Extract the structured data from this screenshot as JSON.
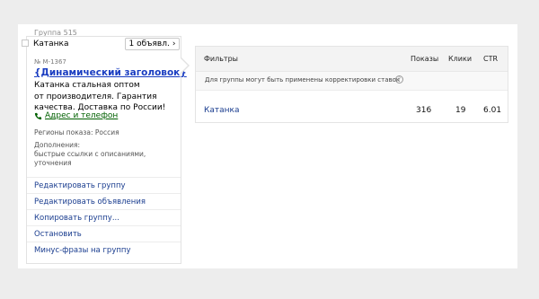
{
  "group": {
    "label": "Группа 515"
  },
  "card": {
    "title": "Катанка",
    "ads_button_label": "1 объявл.",
    "ads_button_chevron": "›",
    "ad_number": "№ М-1367",
    "headline": "{Динамический заголовок}",
    "text_lines": [
      "Катанка стальная оптом",
      "от производителя. Гарантия",
      "качества. Доставка по России!"
    ],
    "contact_label": "Адрес и телефон",
    "regions": "Регионы показа: Россия",
    "extras_title": "Дополнения:",
    "extras_lines": [
      "быстрые ссылки с описаниями,",
      "уточнения"
    ]
  },
  "actions": [
    "Редактировать группу",
    "Редактировать объявления",
    "Копировать группу...",
    "Остановить",
    "Минус-фразы на группу"
  ],
  "table": {
    "headers": {
      "filters": "Фильтры",
      "impressions": "Показы",
      "clicks": "Клики",
      "ctr": "CTR"
    },
    "note": "Для группы могут быть применены корректировки ставок",
    "help_glyph": "?",
    "rows": [
      {
        "filter": "Катанка",
        "impressions": "316",
        "clicks": "19",
        "ctr": "6.01"
      }
    ]
  },
  "icons": {
    "phone": "phone-icon",
    "help": "help-icon",
    "chevron": "chevron-right-icon"
  },
  "colors": {
    "link": "#1a3d8f",
    "headline": "#1a3dc1",
    "contact": "#006000"
  }
}
